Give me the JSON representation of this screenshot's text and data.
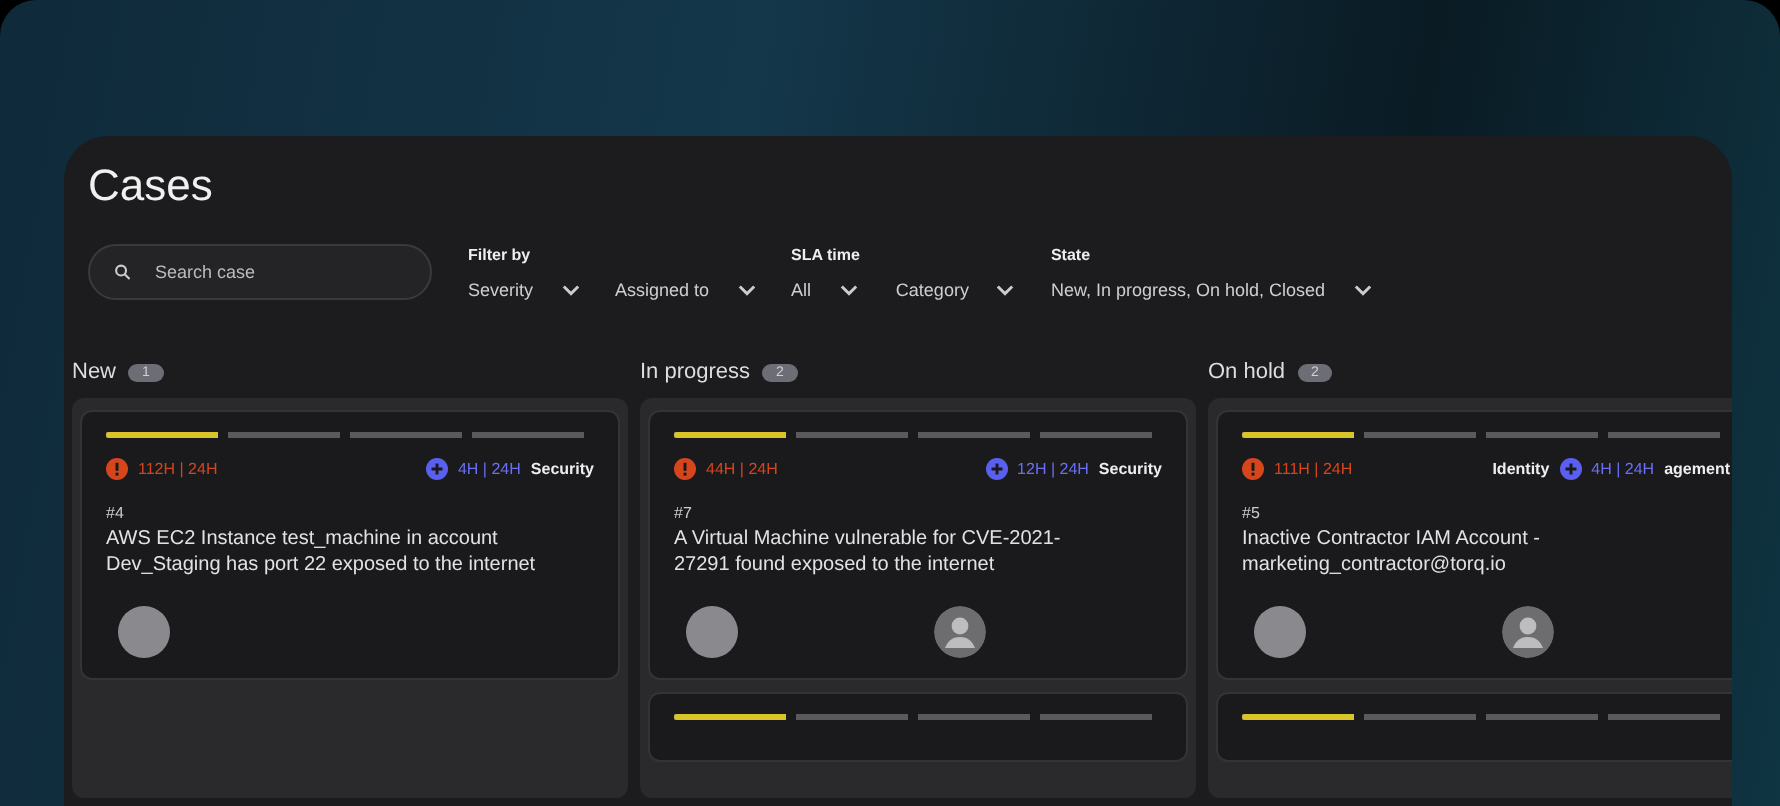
{
  "title": "Cases",
  "search": {
    "placeholder": "Search case"
  },
  "filters": [
    {
      "heading": "Filter by",
      "label": "Severity"
    },
    {
      "label": "Assigned to"
    },
    {
      "heading": "SLA time",
      "label": "All"
    },
    {
      "label": "Category"
    },
    {
      "heading": "State",
      "label": "New, In progress, On hold, Closed"
    }
  ],
  "columns": [
    {
      "name": "New",
      "count": "1",
      "cards": [
        {
          "level": 0.25,
          "overdue": "112H | 24H",
          "sla": "4H | 24H",
          "category": "Security",
          "id": "#4",
          "text": "AWS EC2 Instance test_machine in account Dev_Staging has port 22 exposed to the internet",
          "avatars": [
            {
              "kind": "photo"
            }
          ]
        }
      ]
    },
    {
      "name": "In progress",
      "count": "2",
      "cards": [
        {
          "level": 0.25,
          "overdue": "44H | 24H",
          "sla": "12H | 24H",
          "category": "Security",
          "id": "#7",
          "text": "A Virtual Machine vulnerable for CVE-2021-27291 found exposed to the internet",
          "avatars": [
            {
              "kind": "photo"
            },
            {
              "kind": "unassigned"
            }
          ]
        },
        {
          "level": 0.25
        }
      ]
    },
    {
      "name": "On hold",
      "count": "2",
      "cards": [
        {
          "level": 0.25,
          "overdue": "111H | 24H",
          "category_lead": "Identity",
          "sla": "4H | 24H",
          "category": "agement",
          "id": "#5",
          "text": "Inactive Contractor IAM Account - marketing_contractor@torq.io",
          "avatars": [
            {
              "kind": "photo"
            },
            {
              "kind": "unassigned"
            }
          ]
        },
        {
          "level": 0.25
        }
      ]
    }
  ]
}
